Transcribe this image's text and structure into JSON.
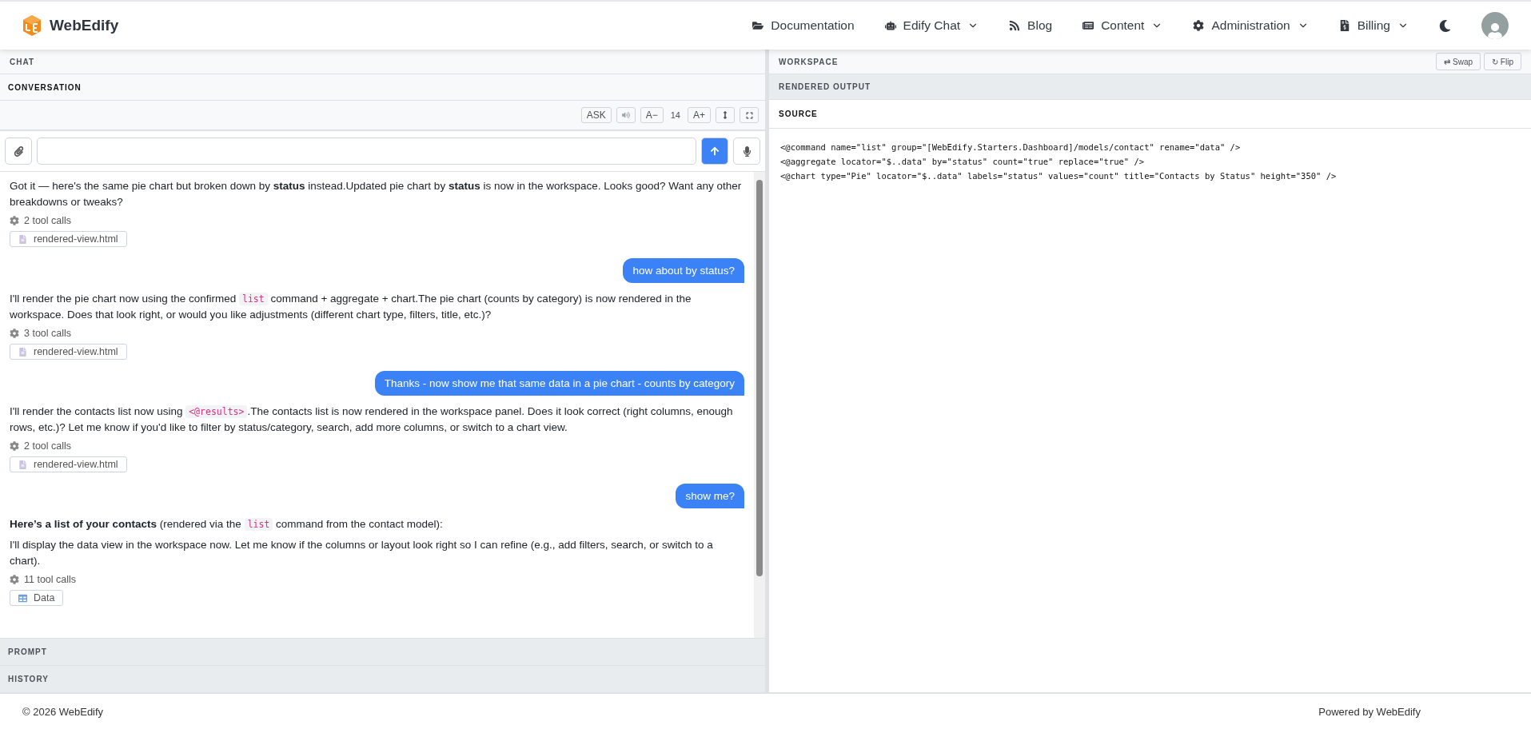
{
  "brand": {
    "name": "WebEdify"
  },
  "nav": [
    {
      "label": "Documentation",
      "dropdown": false
    },
    {
      "label": "Edify Chat",
      "dropdown": true
    },
    {
      "label": "Blog",
      "dropdown": false
    },
    {
      "label": "Content",
      "dropdown": true
    },
    {
      "label": "Administration",
      "dropdown": true
    },
    {
      "label": "Billing",
      "dropdown": true
    }
  ],
  "chat": {
    "title": "CHAT",
    "section": "CONVERSATION",
    "toolbar": [
      {
        "kind": "text",
        "label": "ASK"
      },
      {
        "kind": "speaker"
      },
      {
        "kind": "text",
        "label": "A−"
      },
      {
        "kind": "value",
        "label": "14"
      },
      {
        "kind": "text",
        "label": "A+"
      },
      {
        "kind": "updown"
      },
      {
        "kind": "expand"
      }
    ],
    "messages": [
      {
        "kind": "assistant",
        "paragraphs": [
          [
            {
              "kind": "text",
              "text": "Got it — here's the same pie chart but broken down by **status** instead.Updated pie chart by **status** is now in the workspace. Looks good? Want any other breakdowns or tweaks?"
            }
          ]
        ],
        "tool_calls": "2 tool calls",
        "attachment": {
          "label": "rendered-view.html",
          "kind": "file"
        }
      },
      {
        "kind": "user",
        "text": "how about by status?"
      },
      {
        "kind": "assistant",
        "paragraphs": [
          [
            {
              "kind": "text",
              "text": "I'll render the pie chart now using the confirmed "
            },
            {
              "kind": "code",
              "text": "list"
            },
            {
              "kind": "text",
              "text": " command + aggregate + chart.The pie chart (counts by category) is now rendered in the workspace. Does that look right, or would you like adjustments (different chart type, filters, title, etc.)?"
            }
          ]
        ],
        "tool_calls": "3 tool calls",
        "attachment": {
          "label": "rendered-view.html",
          "kind": "file"
        }
      },
      {
        "kind": "user",
        "text": "Thanks - now show me that same data in a pie chart - counts by category"
      },
      {
        "kind": "assistant",
        "paragraphs": [
          [
            {
              "kind": "text",
              "text": "I'll render the contacts list now using "
            },
            {
              "kind": "code",
              "text": "<@results>"
            },
            {
              "kind": "text",
              "text": ".The contacts list is now rendered in the workspace panel. Does it look correct (right columns, enough rows, etc.)? Let me know if you'd like to filter by status/category, search, add more columns, or switch to a chart view."
            }
          ]
        ],
        "tool_calls": "2 tool calls",
        "attachment": {
          "label": "rendered-view.html",
          "kind": "file"
        }
      },
      {
        "kind": "user",
        "text": "show me?"
      },
      {
        "kind": "assistant",
        "paragraphs": [
          [
            {
              "kind": "text",
              "text": "**Here’s a list of your contacts** (rendered via the "
            },
            {
              "kind": "code",
              "text": "list"
            },
            {
              "kind": "text",
              "text": " command from the contact model):"
            }
          ],
          [
            {
              "kind": "text",
              "text": "I'll display the data view in the workspace now. Let me know if the columns or layout look right so I can refine (e.g., add filters, search, or switch to a chart)."
            }
          ]
        ],
        "tool_calls": "11 tool calls",
        "attachment": {
          "label": "Data",
          "kind": "table"
        }
      }
    ],
    "sections": [
      {
        "label": "PROMPT"
      },
      {
        "label": "HISTORY"
      }
    ]
  },
  "workspace": {
    "title": "WORKSPACE",
    "buttons": [
      {
        "label": "⇄ Swap"
      },
      {
        "label": "↻ Flip"
      }
    ],
    "tabs": [
      {
        "label": "RENDERED OUTPUT",
        "selected": false
      },
      {
        "label": "SOURCE",
        "selected": true
      }
    ],
    "source": [
      "<@command name=\"list\" group=\"[WebEdify.Starters.Dashboard]/models/contact\" rename=\"data\" />",
      "<@aggregate locator=\"$..data\" by=\"status\" count=\"true\" replace=\"true\" />",
      "<@chart type=\"Pie\" locator=\"$..data\" labels=\"status\" values=\"count\" title=\"Contacts by Status\" height=\"350\" />"
    ]
  },
  "footer": {
    "copyright": "© 2026 WebEdify",
    "powered": "Powered by WebEdify"
  }
}
